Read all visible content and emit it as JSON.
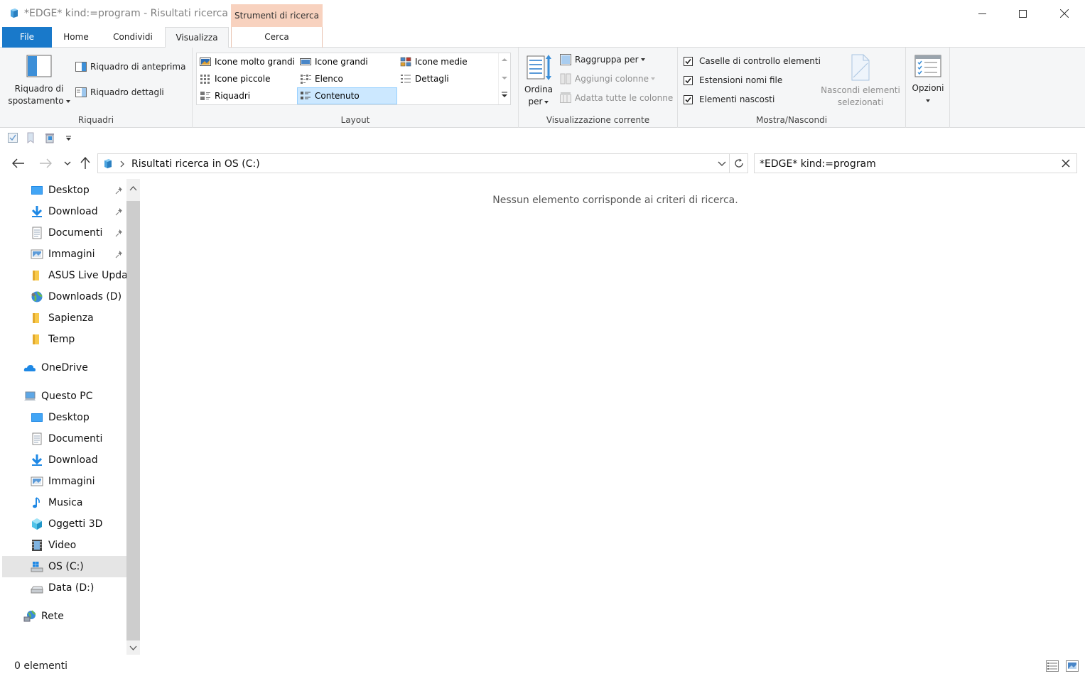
{
  "window": {
    "title": "*EDGE* kind:=program - Risultati ricerca i...",
    "context_tab_header": "Strumenti di ricerca"
  },
  "tabs": {
    "file": "File",
    "home": "Home",
    "condividi": "Condividi",
    "visualizza": "Visualizza",
    "cerca": "Cerca"
  },
  "ribbon": {
    "riquadri": {
      "label": "Riquadri",
      "navigation_pane_line1": "Riquadro di",
      "navigation_pane_line2": "spostamento",
      "preview_pane": "Riquadro di anteprima",
      "details_pane": "Riquadro dettagli"
    },
    "layout": {
      "label": "Layout",
      "items": [
        "Icone molto grandi",
        "Icone grandi",
        "Icone medie",
        "Icone piccole",
        "Elenco",
        "Dettagli",
        "Riquadri",
        "Contenuto"
      ],
      "selected": "Contenuto"
    },
    "current_view": {
      "label": "Visualizzazione corrente",
      "sort_line1": "Ordina",
      "sort_line2": "per",
      "group_by": "Raggruppa per",
      "add_columns": "Aggiungi colonne",
      "fit_columns": "Adatta tutte le colonne"
    },
    "show_hide": {
      "label": "Mostra/Nascondi",
      "item_checkboxes": "Caselle di controllo elementi",
      "file_extensions": "Estensioni nomi file",
      "hidden_items": "Elementi nascosti",
      "item_checkboxes_checked": true,
      "file_extensions_checked": true,
      "hidden_items_checked": true,
      "hide_selected_line1": "Nascondi elementi",
      "hide_selected_line2": "selezionati"
    },
    "options": "Opzioni"
  },
  "address": {
    "path": "Risultati ricerca in OS (C:)"
  },
  "search": {
    "value": "*EDGE* kind:=program"
  },
  "nav": {
    "items": [
      {
        "label": "Desktop",
        "pinned": true
      },
      {
        "label": "Download",
        "pinned": true
      },
      {
        "label": "Documenti",
        "pinned": true
      },
      {
        "label": "Immagini",
        "pinned": true
      },
      {
        "label": "ASUS Live Updat"
      },
      {
        "label": "Downloads (D)"
      },
      {
        "label": "Sapienza"
      },
      {
        "label": "Temp"
      },
      {
        "label": "OneDrive"
      },
      {
        "label": "Questo PC"
      },
      {
        "label": "Desktop"
      },
      {
        "label": "Documenti"
      },
      {
        "label": "Download"
      },
      {
        "label": "Immagini"
      },
      {
        "label": "Musica"
      },
      {
        "label": "Oggetti 3D"
      },
      {
        "label": "Video"
      },
      {
        "label": "OS (C:)",
        "selected": true
      },
      {
        "label": "Data (D:)"
      },
      {
        "label": "Rete"
      }
    ]
  },
  "content": {
    "empty_message": "Nessun elemento corrisponde ai criteri di ricerca."
  },
  "status": {
    "count": "0 elementi"
  },
  "colors": {
    "file_tab": "#1979ca",
    "context_tab": "#f8d2bf",
    "selection": "#cce8ff",
    "ribbon_bg": "#f5f6f7"
  }
}
